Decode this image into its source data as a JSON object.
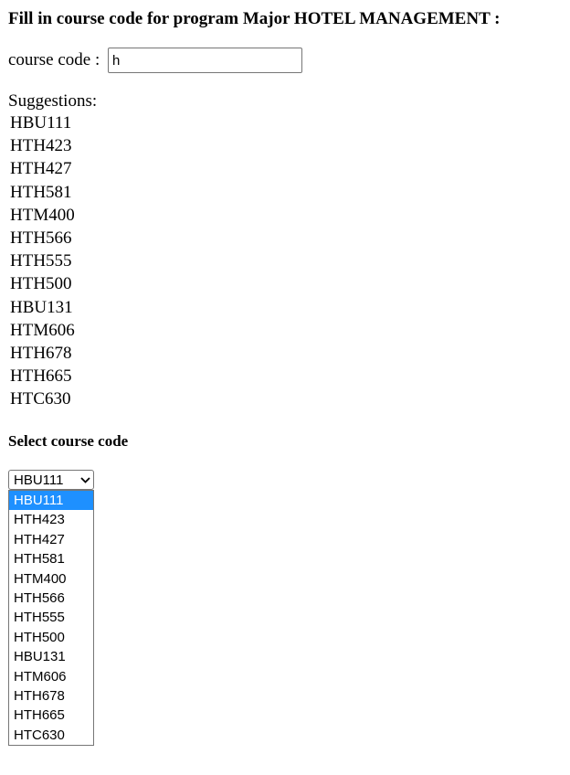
{
  "heading": "Fill in course code for program Major HOTEL MANAGEMENT :",
  "course_code": {
    "label": "course code : ",
    "value": "h"
  },
  "suggestions": {
    "title": "Suggestions:",
    "items": [
      "HBU111",
      "HTH423",
      "HTH427",
      "HTH581",
      "HTM400",
      "HTH566",
      "HTH555",
      "HTH500",
      "HBU131",
      "HTM606",
      "HTH678",
      "HTH665",
      "HTC630"
    ]
  },
  "select": {
    "heading": "Select course code",
    "selected": "HBU111",
    "options": [
      "HBU111",
      "HTH423",
      "HTH427",
      "HTH581",
      "HTM400",
      "HTH566",
      "HTH555",
      "HTH500",
      "HBU131",
      "HTM606",
      "HTH678",
      "HTH665",
      "HTC630"
    ],
    "highlight_color": "#1e90ff"
  }
}
